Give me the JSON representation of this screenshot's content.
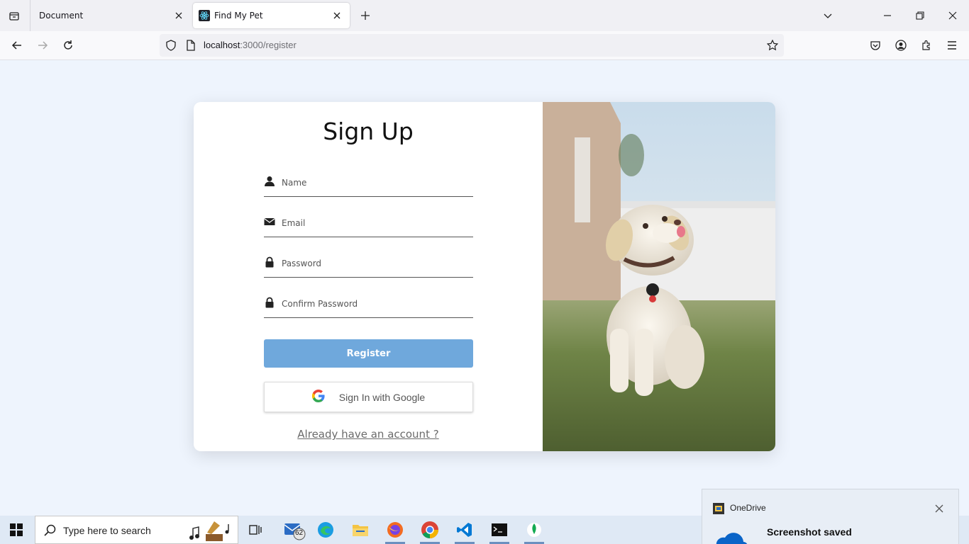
{
  "browser": {
    "tabs": [
      {
        "label": "Document",
        "active": false
      },
      {
        "label": "Find My Pet",
        "active": true
      }
    ],
    "url": {
      "host": "localhost",
      "path": ":3000/register"
    }
  },
  "page": {
    "title": "Sign Up",
    "fields": [
      {
        "placeholder": "Name",
        "icon": "user-icon"
      },
      {
        "placeholder": "Email",
        "icon": "envelope-icon"
      },
      {
        "placeholder": "Password",
        "icon": "lock-icon"
      },
      {
        "placeholder": "Confirm Password",
        "icon": "lock-icon"
      }
    ],
    "register_label": "Register",
    "google_label": "Sign In with Google",
    "login_link": "Already have an account ?",
    "photo": "puppy on grass"
  },
  "taskbar": {
    "search_placeholder": "Type here to search",
    "mail_badge": "62"
  },
  "toast": {
    "app": "OneDrive",
    "heading": "Screenshot saved"
  },
  "colors": {
    "page_bg": "#eef4fd",
    "register_button": "#6fa8dc"
  }
}
